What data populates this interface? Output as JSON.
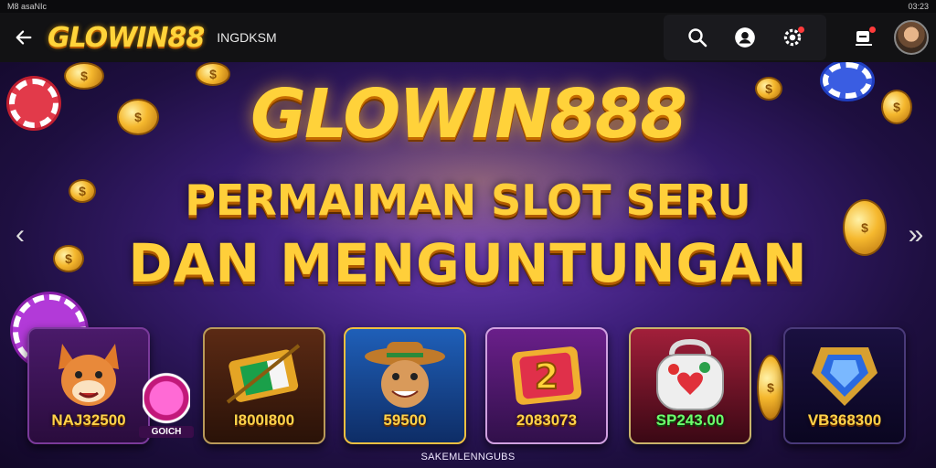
{
  "status_bar": {
    "left_text": "M8 asaNIc",
    "right_text": "03:23"
  },
  "header": {
    "logo": "GLOWIN88",
    "subtitle": "INGDKSM"
  },
  "icons": {
    "back": "back-arrow-icon",
    "search": "search-icon",
    "profile": "user-icon",
    "settings": "gear-icon",
    "inbox": "inbox-icon",
    "avatar": "avatar-image"
  },
  "banner": {
    "title": "GLOWIN888",
    "line1": "PERMAIMAN SLOT SERU",
    "line2": "DAN MENGUNTUNGAN",
    "prev_arrow": "‹",
    "next_arrow": "»",
    "caption": "SAKEMLENNGUBS"
  },
  "coin_badge": {
    "label": "GOICH"
  },
  "games": [
    {
      "name": "fox-game",
      "amount": "NAJ32500"
    },
    {
      "name": "flag-game",
      "amount": "I800I800"
    },
    {
      "name": "cowboy-game",
      "amount": "59500"
    },
    {
      "name": "lucky-2-game",
      "amount": "2083073"
    },
    {
      "name": "lucky-bag-game",
      "amount": "SP243.00"
    },
    {
      "name": "shield-game",
      "amount": "VB368300"
    }
  ],
  "colors": {
    "gold": "#ffd23a",
    "banner_purple": "#3d1f7a",
    "notification": "#ff3b3b"
  }
}
